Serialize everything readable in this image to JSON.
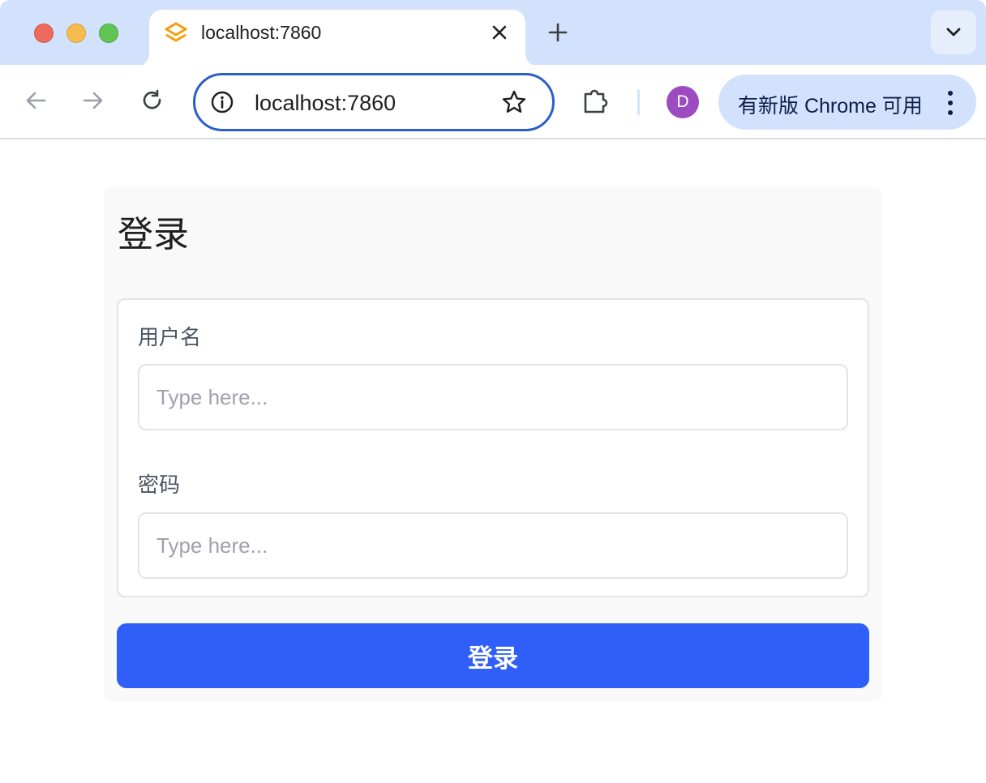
{
  "browser": {
    "tab": {
      "title": "localhost:7860",
      "favicon": "gradio-logo-icon",
      "favicon_color": "#f59e0b"
    },
    "address_bar": {
      "url": "localhost:7860"
    },
    "profile_initial": "D",
    "profile_color": "#9c4bc1",
    "update_chip": {
      "label": "有新版 Chrome 可用"
    },
    "accent_color": "#d3e2fc"
  },
  "login_form": {
    "title": "登录",
    "username": {
      "label": "用户名",
      "placeholder": "Type here...",
      "value": ""
    },
    "password": {
      "label": "密码",
      "placeholder": "Type here...",
      "value": ""
    },
    "submit_label": "登录",
    "submit_color": "#2f5ef9"
  }
}
